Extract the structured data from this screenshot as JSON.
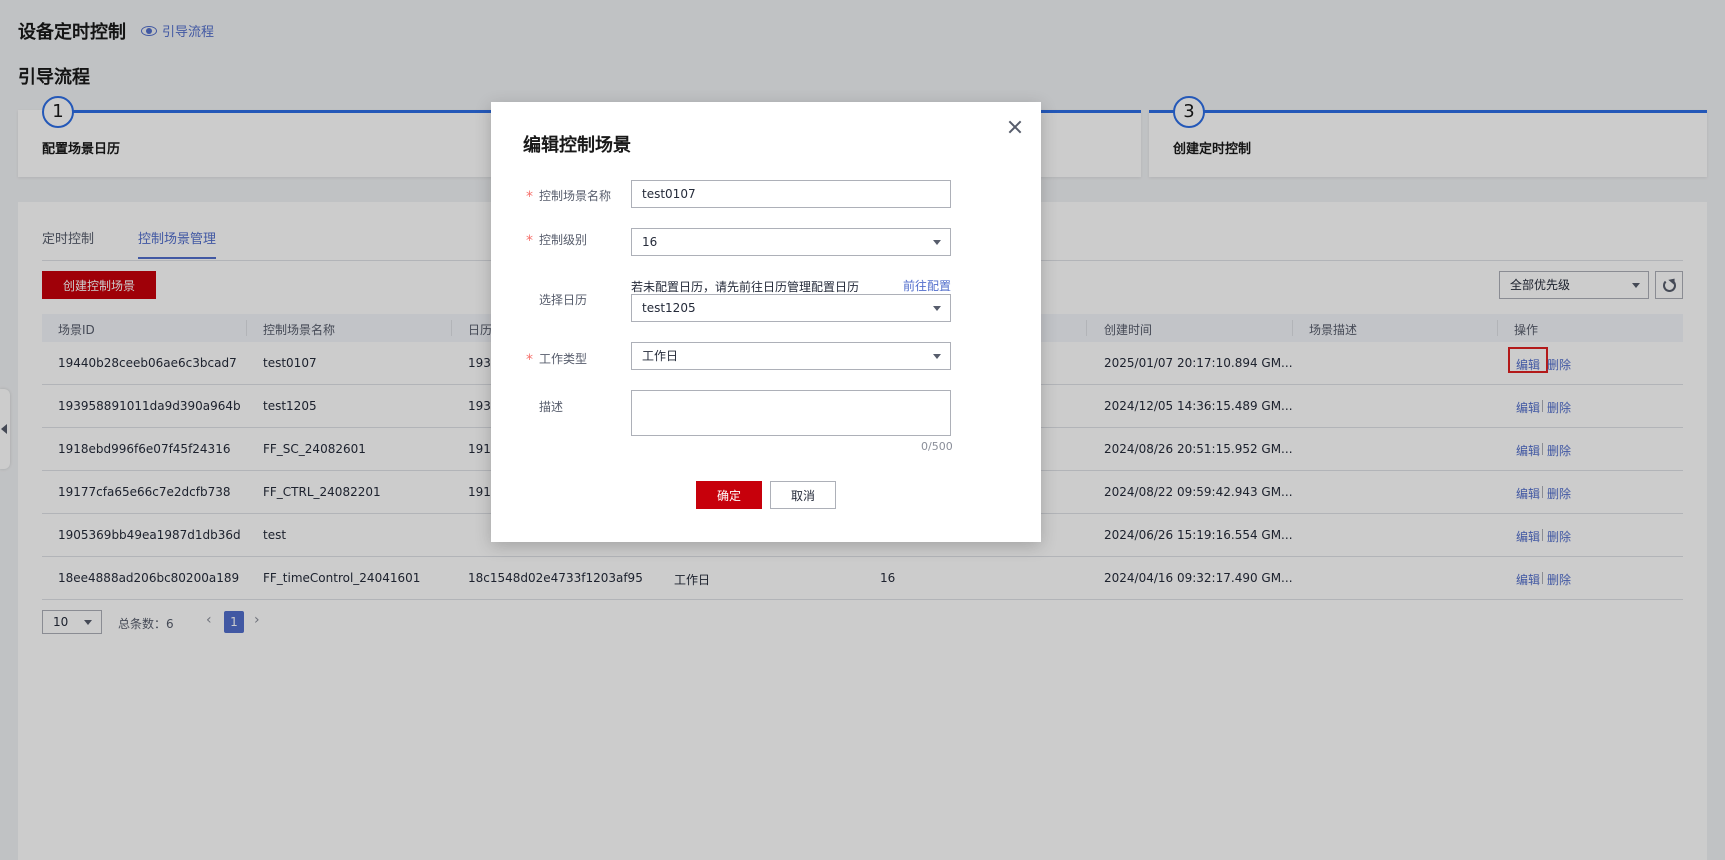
{
  "header": {
    "title": "设备定时控制",
    "guide_link": "引导流程"
  },
  "guide": {
    "title": "引导流程",
    "steps": [
      {
        "number": "1",
        "label": "配置场景日历"
      },
      {
        "number": "3",
        "label": "创建定时控制"
      }
    ]
  },
  "tabs": [
    {
      "label": "定时控制",
      "active": false
    },
    {
      "label": "控制场景管理",
      "active": true
    }
  ],
  "toolbar": {
    "create_button": "创建控制场景",
    "priority_filter": "全部优先级"
  },
  "table": {
    "columns": {
      "id": "场景ID",
      "name": "控制场景名称",
      "calendar": "日历",
      "created": "创建时间",
      "desc": "场景描述",
      "ops": "操作"
    },
    "rows": [
      {
        "id": "19440b28ceeb06ae6c3bcad7",
        "name": "test0107",
        "calendar": "193",
        "work_type": "",
        "level": "",
        "created": "2025/01/07 20:17:10.894 GM...",
        "desc": "",
        "edit": "编辑",
        "delete": "删除"
      },
      {
        "id": "193958891011da9d390a964b",
        "name": "test1205",
        "calendar": "193",
        "work_type": "",
        "level": "",
        "created": "2024/12/05 14:36:15.489 GM...",
        "desc": "",
        "edit": "编辑",
        "delete": "删除"
      },
      {
        "id": "1918ebd996f6e07f45f24316",
        "name": "FF_SC_24082601",
        "calendar": "1918",
        "work_type": "",
        "level": "",
        "created": "2024/08/26 20:51:15.952 GM...",
        "desc": "",
        "edit": "编辑",
        "delete": "删除"
      },
      {
        "id": "19177cfa65e66c7e2dcfb738",
        "name": "FF_CTRL_24082201",
        "calendar": "1917",
        "work_type": "",
        "level": "",
        "created": "2024/08/22 09:59:42.943 GM...",
        "desc": "",
        "edit": "编辑",
        "delete": "删除"
      },
      {
        "id": "1905369bb49ea1987d1db36d",
        "name": "test",
        "calendar": "",
        "work_type": "",
        "level": "",
        "created": "2024/06/26 15:19:16.554 GM...",
        "desc": "",
        "edit": "编辑",
        "delete": "删除"
      },
      {
        "id": "18ee4888ad206bc80200a189",
        "name": "FF_timeControl_24041601",
        "calendar": "18c1548d02e4733f1203af95",
        "work_type": "工作日",
        "level": "16",
        "created": "2024/04/16 09:32:17.490 GM...",
        "desc": "",
        "edit": "编辑",
        "delete": "删除"
      }
    ]
  },
  "pager": {
    "page_size": "10",
    "total": "总条数：6",
    "current": "1",
    "prev": "‹",
    "next": "›"
  },
  "modal": {
    "title": "编辑控制场景",
    "fields": {
      "name_label": "控制场景名称",
      "name_value": "test0107",
      "level_label": "控制级别",
      "level_value": "16",
      "calendar_label": "选择日历",
      "calendar_hint": "若未配置日历，请先前往日历管理配置日历",
      "calendar_link": "前往配置",
      "calendar_value": "test1205",
      "worktype_label": "工作类型",
      "worktype_value": "工作日",
      "desc_label": "描述",
      "desc_count": "0/500"
    },
    "ok_button": "确定",
    "cancel_button": "取消"
  }
}
